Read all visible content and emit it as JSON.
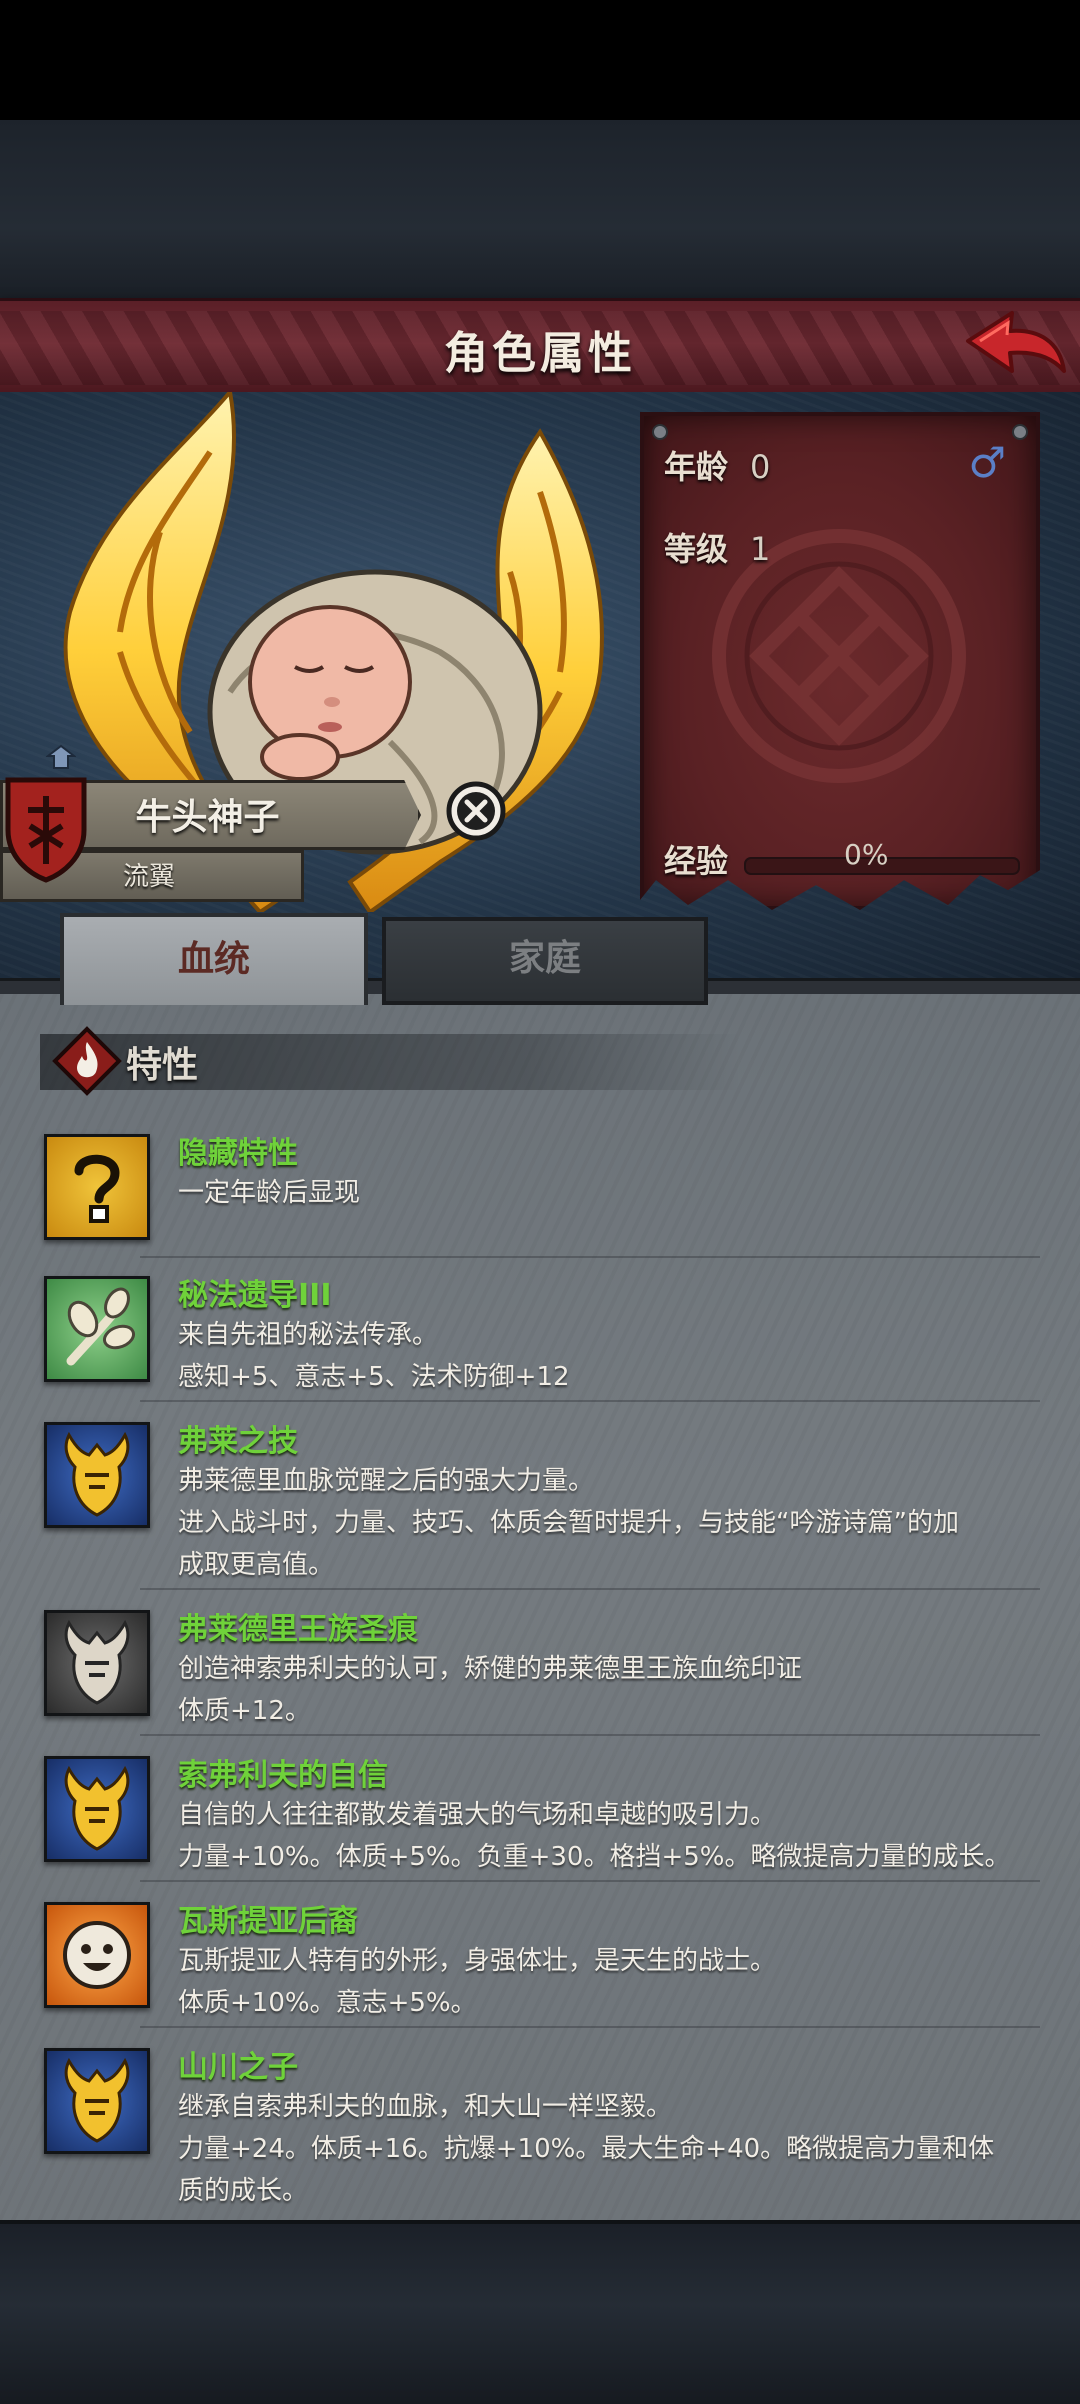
{
  "header": {
    "title": "角色属性"
  },
  "character": {
    "name": "牛头神子",
    "title": "流翼",
    "age_label": "年龄",
    "age_value": "0",
    "level_label": "等级",
    "level_value": "1",
    "gender_symbol": "♂",
    "exp_label": "经验",
    "exp_value": "0%",
    "exp_fraction": 0.0
  },
  "tabs": [
    {
      "label": "血统",
      "active": true
    },
    {
      "label": "家庭",
      "active": false
    }
  ],
  "traits_section": {
    "title": "特性"
  },
  "traits": [
    {
      "name": "隐藏特性",
      "icon": "question-mark-icon",
      "desc": [
        "",
        "一定年龄后显现"
      ]
    },
    {
      "name": "秘法遗导III",
      "icon": "branch-icon",
      "desc": [
        "来自先祖的秘法传承。",
        "感知+5、意志+5、法术防御+12"
      ]
    },
    {
      "name": "弗莱之技",
      "icon": "golden-helm-icon",
      "desc": [
        "弗莱德里血脉觉醒之后的强大力量。",
        "进入战斗时，力量、技巧、体质会暂时提升，与技能“吟游诗篇”的加",
        "成取更高值。"
      ]
    },
    {
      "name": "弗莱德里王族圣痕",
      "icon": "silver-helm-icon",
      "desc": [
        "创造神索弗利夫的认可，矫健的弗莱德里王族血统印证",
        "体质+12。"
      ]
    },
    {
      "name": "索弗利夫的自信",
      "icon": "golden-helm-icon",
      "desc": [
        "自信的人往往都散发着强大的气场和卓越的吸引力。",
        "力量+10%。体质+5%。负重+30。格挡+5%。略微提高力量的成长。"
      ]
    },
    {
      "name": "瓦斯提亚后裔",
      "icon": "smiling-face-icon",
      "desc": [
        "瓦斯提亚人特有的外形，身强体壮，是天生的战士。",
        "体质+10%。意志+5%。"
      ]
    },
    {
      "name": "山川之子",
      "icon": "golden-helm-icon",
      "desc": [
        "继承自索弗利夫的血脉，和大山一样坚毅。",
        "力量+24。体质+16。抗爆+10%。最大生命+40。略微提高力量和体",
        "质的成长。"
      ]
    }
  ]
}
